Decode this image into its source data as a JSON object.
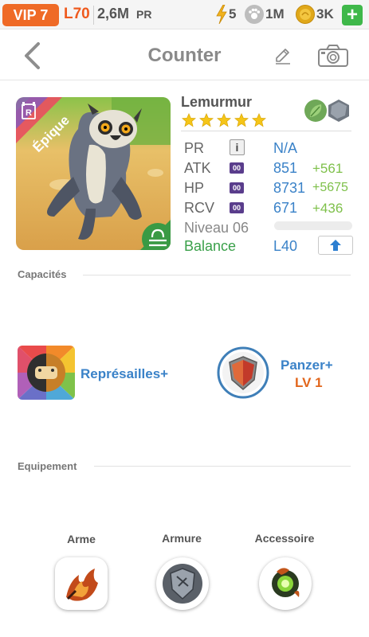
{
  "status_bar": {
    "vip": "VIP 7",
    "player_level": "L70",
    "power": "2,6M",
    "power_unit": "PR",
    "energy": "5",
    "paws": "1M",
    "coins": "3K",
    "add": "+"
  },
  "header": {
    "title": "Counter",
    "icons": [
      "back-icon",
      "pencil-icon",
      "camera-icon"
    ]
  },
  "creature": {
    "name": "Lemurmur",
    "rarity": "Épique",
    "rarity_letter": "R",
    "stars": 5,
    "elements": [
      "leaf",
      "stone"
    ],
    "stats": [
      {
        "label": "PR",
        "value": "N/A",
        "bonus": ""
      },
      {
        "label": "ATK",
        "badge": "00",
        "value": "851",
        "bonus": "+561"
      },
      {
        "label": "HP",
        "badge": "00",
        "value": "8731",
        "bonus": "+5675"
      },
      {
        "label": "RCV",
        "badge": "00",
        "value": "671",
        "bonus": "+436"
      }
    ],
    "level_label": "Niveau 06",
    "level_progress": 0,
    "balance_label": "Balance",
    "balance_value": "L40",
    "pr_info": "i"
  },
  "sections": {
    "abilities": "Capacités",
    "equipment": "Equipement"
  },
  "abilities": [
    {
      "name": "Représailles+",
      "level": ""
    },
    {
      "name": "Panzer+",
      "level": "LV 1"
    }
  ],
  "equipment": [
    {
      "label": "Arme"
    },
    {
      "label": "Armure"
    },
    {
      "label": "Accessoire"
    }
  ],
  "colors": {
    "accent_blue": "#3a82c8",
    "bonus_green": "#7ec04a",
    "vip_orange": "#ef6a26",
    "level_orange": "#e2661c",
    "balance_green": "#3aa04a"
  }
}
